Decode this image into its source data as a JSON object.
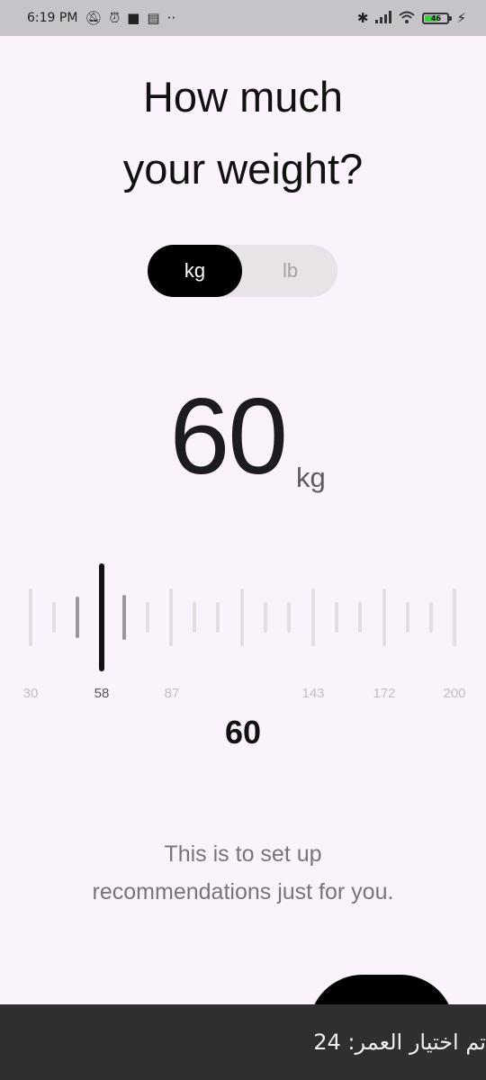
{
  "status_bar": {
    "time": "6:19 PM",
    "left_icons": [
      "silent-icon",
      "alarm-icon",
      "video-icon",
      "card-icon",
      "more-dots-icon"
    ],
    "right_icons": [
      "bluetooth-icon",
      "signal-icon",
      "wifi-icon",
      "battery-icon",
      "charging-icon"
    ],
    "battery_level": "46"
  },
  "screen": {
    "question_line1": "How much",
    "question_line2": "your weight?",
    "unit_kg": "kg",
    "unit_lb": "lb",
    "selected_unit": "kg",
    "value": "60",
    "value_unit": "kg"
  },
  "ruler": {
    "labels": [
      "30",
      "58",
      "87",
      "143",
      "172",
      "200"
    ],
    "active_label": "58",
    "selected_value": "60"
  },
  "hint": {
    "line1": "This is to set up",
    "line2": "recommendations just for you."
  },
  "snackbar": {
    "message": "تم اختيار العمر: 24"
  },
  "colors": {
    "background": "#fbf3fb",
    "accent": "#000000",
    "snackbar": "#2f2e31"
  }
}
